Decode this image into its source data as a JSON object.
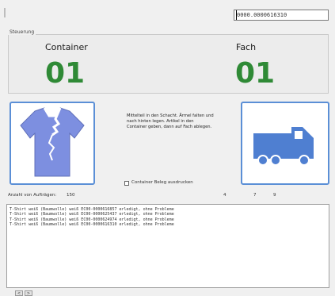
{
  "header": {
    "barcode_value": "0000.0000616310"
  },
  "control_group": {
    "legend": "Steuerung",
    "container_label": "Container",
    "container_number": "01",
    "fach_label": "Fach",
    "fach_number": "01"
  },
  "instructions": "Mittelteil in den Schacht. Ärmel falten und nach hinten legen. Artikel in den Container geben, dann auf Fach ablegen.",
  "checkbox": {
    "label": "Container Beleg ausdrucken",
    "checked": false
  },
  "status": {
    "order_count_label": "Anzahl von Aufträgen:",
    "order_count_value": "150",
    "counter_a": "4",
    "counter_b": "7",
    "counter_c": "9"
  },
  "log_lines": [
    "T-Shirt weiß (Baumwolle) weiß EC00-0000616857 erledigt, ohne Probleme",
    "T-Shirt weiß (Baumwolle) weiß EC00-0000625437 erledigt, ohne Probleme",
    "T-Shirt weiß (Baumwolle) weiß EC00-0000624974 erledigt, ohne Probleme",
    "T-Shirt weiß (Baumwolle) weiß EC00-0000616310 erledigt, ohne Probleme"
  ],
  "bottom_buttons": [
    "<",
    ">"
  ],
  "colors": {
    "number_green": "#2f8a36",
    "frame_blue": "#5b8fd6",
    "shirt_blue": "#7d8fe0",
    "truck_blue": "#4f7fd1"
  }
}
